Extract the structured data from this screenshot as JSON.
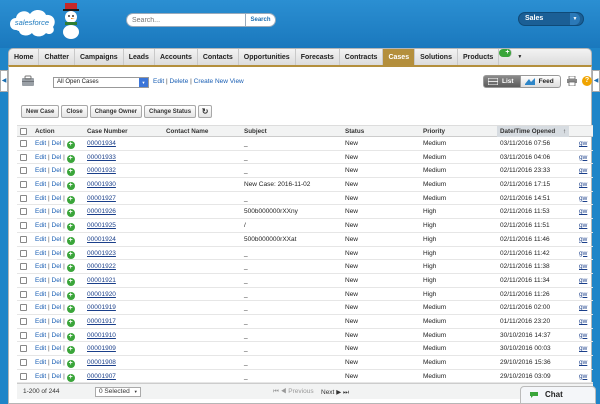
{
  "header": {
    "logo_text": "salesforce",
    "search_placeholder": "Search...",
    "search_button": "Search",
    "app_menu": "Sales"
  },
  "tabs": [
    "Home",
    "Chatter",
    "Campaigns",
    "Leads",
    "Accounts",
    "Contacts",
    "Opportunities",
    "Forecasts",
    "Contracts",
    "Cases",
    "Solutions",
    "Products",
    "+"
  ],
  "active_tab": "Cases",
  "view": {
    "selected": "All Open Cases",
    "edit": "Edit",
    "delete": "Delete",
    "create": "Create New View",
    "list_label": "List",
    "feed_label": "Feed"
  },
  "buttons": {
    "new_case": "New Case",
    "close": "Close",
    "change_owner": "Change Owner",
    "change_status": "Change Status"
  },
  "columns": {
    "action": "Action",
    "case_number": "Case Number",
    "contact_name": "Contact Name",
    "subject": "Subject",
    "status": "Status",
    "priority": "Priority",
    "date_opened": "Date/Time Opened",
    "sort_arrow": "↑"
  },
  "row_actions": {
    "edit": "Edit",
    "del": "Del"
  },
  "rows": [
    {
      "case": "00001934",
      "subject": "_",
      "status": "New",
      "priority": "Medium",
      "date": "03/11/2016 07:56",
      "owner": "gw"
    },
    {
      "case": "00001933",
      "subject": "_",
      "status": "New",
      "priority": "Medium",
      "date": "03/11/2016 04:06",
      "owner": "gw"
    },
    {
      "case": "00001932",
      "subject": "_",
      "status": "New",
      "priority": "Medium",
      "date": "02/11/2016 23:33",
      "owner": "gw"
    },
    {
      "case": "00001930",
      "subject": "New Case: 2016-11-02",
      "status": "New",
      "priority": "Medium",
      "date": "02/11/2016 17:15",
      "owner": "gw"
    },
    {
      "case": "00001927",
      "subject": "_",
      "status": "New",
      "priority": "Medium",
      "date": "02/11/2016 14:51",
      "owner": "gw"
    },
    {
      "case": "00001926",
      "subject": "500b000000rXXny",
      "status": "New",
      "priority": "High",
      "date": "02/11/2016 11:53",
      "owner": "gw"
    },
    {
      "case": "00001925",
      "subject": "/",
      "status": "New",
      "priority": "High",
      "date": "02/11/2016 11:51",
      "owner": "gw"
    },
    {
      "case": "00001924",
      "subject": "500b000000rXXat",
      "status": "New",
      "priority": "High",
      "date": "02/11/2016 11:46",
      "owner": "gw"
    },
    {
      "case": "00001923",
      "subject": "_",
      "status": "New",
      "priority": "High",
      "date": "02/11/2016 11:42",
      "owner": "gw"
    },
    {
      "case": "00001922",
      "subject": "_",
      "status": "New",
      "priority": "High",
      "date": "02/11/2016 11:38",
      "owner": "gw"
    },
    {
      "case": "00001921",
      "subject": "_",
      "status": "New",
      "priority": "High",
      "date": "02/11/2016 11:34",
      "owner": "gw"
    },
    {
      "case": "00001920",
      "subject": "_",
      "status": "New",
      "priority": "High",
      "date": "02/11/2016 11:26",
      "owner": "gw"
    },
    {
      "case": "00001919",
      "subject": "_",
      "status": "New",
      "priority": "Medium",
      "date": "02/11/2016 02:00",
      "owner": "gw"
    },
    {
      "case": "00001917",
      "subject": "_",
      "status": "New",
      "priority": "Medium",
      "date": "01/11/2016 23:20",
      "owner": "gw"
    },
    {
      "case": "00001910",
      "subject": "_",
      "status": "New",
      "priority": "Medium",
      "date": "30/10/2016 14:37",
      "owner": "gw"
    },
    {
      "case": "00001909",
      "subject": "_",
      "status": "New",
      "priority": "Medium",
      "date": "30/10/2016 00:03",
      "owner": "gw"
    },
    {
      "case": "00001908",
      "subject": "_",
      "status": "New",
      "priority": "Medium",
      "date": "29/10/2016 15:36",
      "owner": "gw"
    },
    {
      "case": "00001907",
      "subject": "_",
      "status": "New",
      "priority": "Medium",
      "date": "29/10/2016 03:09",
      "owner": "gw"
    }
  ],
  "footer": {
    "range": "1-200 of 244",
    "selected": "0 Selected",
    "previous": "Previous",
    "next": "Next"
  },
  "chat": "Chat"
}
